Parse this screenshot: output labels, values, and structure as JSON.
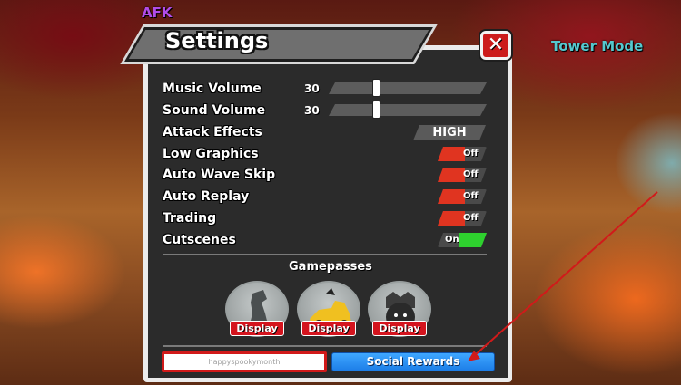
{
  "hud": {
    "afk_label": "AFK",
    "tower_mode_label": "Tower Mode"
  },
  "settings": {
    "title": "Settings",
    "close_icon": "close-icon",
    "music_volume": {
      "label": "Music Volume",
      "value": "30",
      "level_fraction": 0.3
    },
    "sound_volume": {
      "label": "Sound Volume",
      "value": "30",
      "level_fraction": 0.3
    },
    "attack_effects": {
      "label": "Attack Effects",
      "value": "HIGH"
    },
    "toggles": [
      {
        "label": "Low Graphics",
        "state": "Off"
      },
      {
        "label": "Auto Wave Skip",
        "state": "Off"
      },
      {
        "label": "Auto Replay",
        "state": "Off"
      },
      {
        "label": "Trading",
        "state": "Off"
      },
      {
        "label": "Cutscenes",
        "state": "On"
      }
    ],
    "gamepasses": {
      "title": "Gamepasses",
      "items": [
        {
          "icon": "gamepass-character-icon",
          "button": "Display"
        },
        {
          "icon": "gamepass-vehicle-icon",
          "button": "Display"
        },
        {
          "icon": "gamepass-tower-icon",
          "button": "Display"
        }
      ]
    },
    "code_input": {
      "value": "happyspookymonth"
    },
    "social_rewards_label": "Social Rewards"
  },
  "colors": {
    "panel": "#2b2b2b",
    "toggle_off": "#e03420",
    "toggle_on": "#2ed02e",
    "display_button": "#d4141e",
    "social_button": "#2b8ff5",
    "annotation": "#d11a1a"
  }
}
